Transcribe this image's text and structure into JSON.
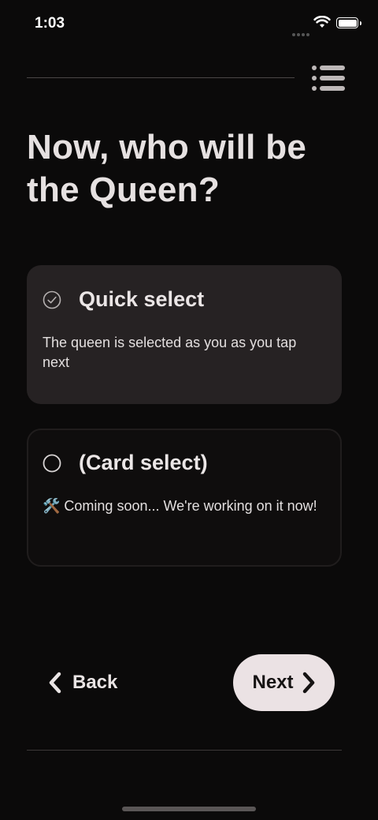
{
  "status_bar": {
    "time": "1:03"
  },
  "header": {
    "title": "Now, who will be the Queen?"
  },
  "options": [
    {
      "title": "Quick select",
      "description": "The queen is selected as you as you tap next",
      "selected": true
    },
    {
      "title": "(Card select)",
      "description": "🛠️ Coming soon... We're working on it now!",
      "selected": false
    }
  ],
  "nav": {
    "back_label": "Back",
    "next_label": "Next"
  },
  "colors": {
    "background": "#0b0a0a",
    "selected_card": "#262223",
    "next_button": "#ebe2e4"
  }
}
